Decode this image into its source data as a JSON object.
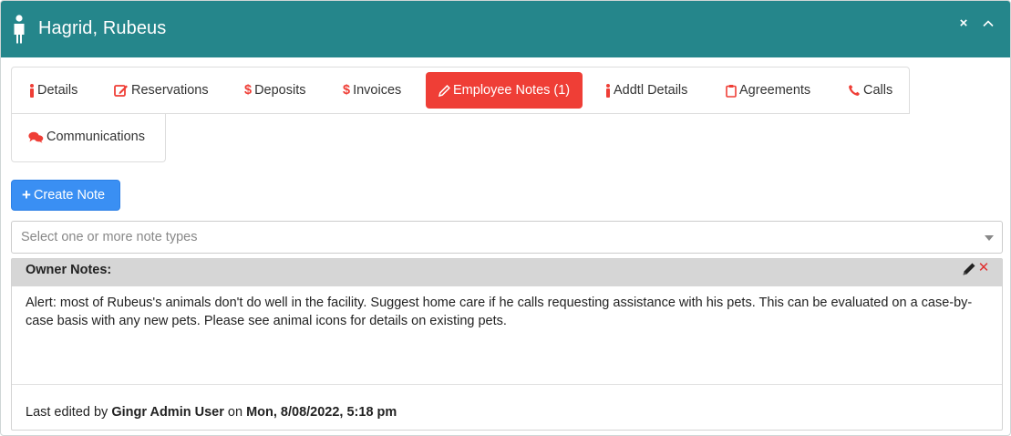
{
  "header": {
    "title": "Hagrid, Rubeus",
    "close_glyph": "×",
    "icons": {
      "person": "person-icon",
      "close": "close-icon",
      "collapse": "chevron-up-icon"
    },
    "colors": {
      "background": "#25868b",
      "text": "#ffffff"
    }
  },
  "tabs": [
    {
      "label": "Details",
      "icon": "info-icon",
      "active": false
    },
    {
      "label": "Reservations",
      "icon": "edit-square-icon",
      "active": false
    },
    {
      "label": "Deposits",
      "icon": "dollar-icon",
      "active": false
    },
    {
      "label": "Invoices",
      "icon": "dollar-icon",
      "active": false
    },
    {
      "label": "Employee Notes (1)",
      "icon": "pencil-icon",
      "active": true
    },
    {
      "label": "Addtl Details",
      "icon": "info-icon",
      "active": false
    },
    {
      "label": "Agreements",
      "icon": "clipboard-icon",
      "active": false
    },
    {
      "label": "Calls",
      "icon": "phone-icon",
      "active": false
    },
    {
      "label": "Communications",
      "icon": "comments-icon",
      "active": false
    }
  ],
  "toolbar": {
    "create_label": "Create Note",
    "create_glyph": "+"
  },
  "note_type_select": {
    "placeholder": "Select one or more note types"
  },
  "notes": [
    {
      "type": "Owner Notes:",
      "delete_glyph": "✕",
      "body": "Alert: most of Rubeus's animals don't do well in the facility. Suggest home care if he calls requesting assistance with his pets. This can be evaluated on a case-by-case basis with any new pets. Please see animal icons for details on existing pets.",
      "footer": {
        "prefix": "Last edited by",
        "user": "Gingr Admin User",
        "on": "on",
        "date": "Mon, 8/08/2022, 5:18 pm"
      }
    }
  ],
  "colors": {
    "accent_red": "#ef3e36",
    "primary_blue": "#3a8ff3",
    "note_header_gray": "#d6d6d6"
  }
}
